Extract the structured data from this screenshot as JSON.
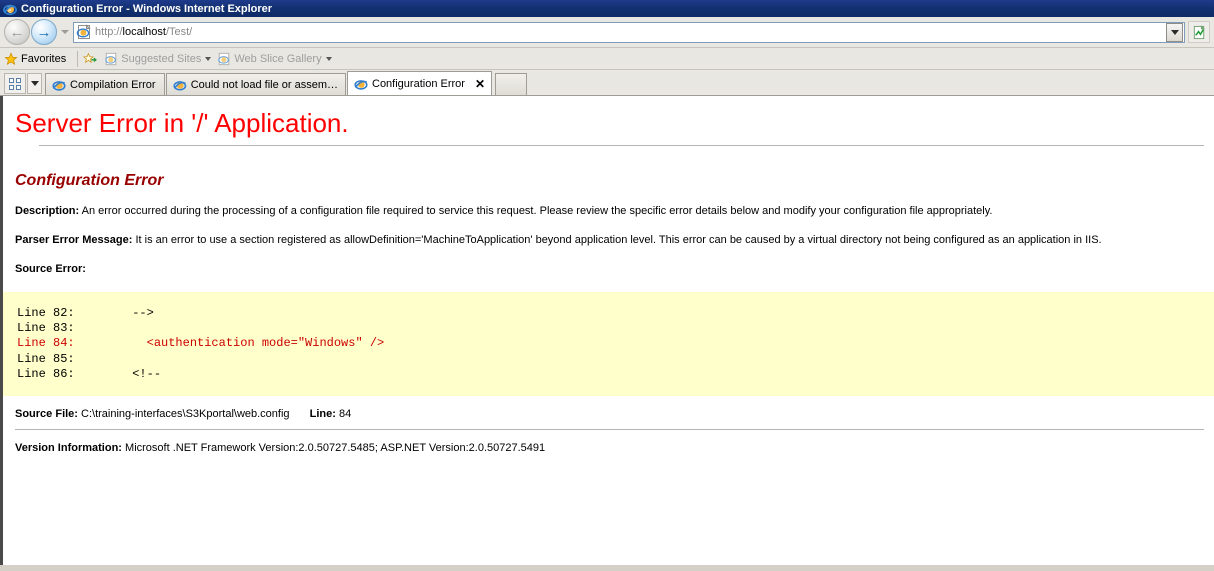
{
  "window": {
    "title": "Configuration Error - Windows Internet Explorer",
    "app_icon": "ie-logo-icon"
  },
  "navigation": {
    "back_label": "Back",
    "forward_label": "Forward",
    "history_dropdown_label": "Recent Pages",
    "address_scheme": "http://",
    "address_host": "localhost",
    "address_path": "/Test/",
    "address_full": "http://localhost/Test/",
    "address_dropdown_label": "Address history",
    "go_label": "Refresh"
  },
  "favorites_bar": {
    "favorites_label": "Favorites",
    "add_to_favorites_label": "Add to Favorites Bar",
    "items": [
      {
        "label": "Suggested Sites",
        "has_caret": true,
        "dimmed": true
      },
      {
        "label": "Web Slice Gallery",
        "has_caret": true,
        "dimmed": true
      }
    ]
  },
  "tabbar": {
    "quick_tabs_label": "Quick Tabs",
    "tab_list_label": "Tab List",
    "new_tab_label": "New Tab",
    "tabs": [
      {
        "label": "Compilation Error",
        "active": false,
        "close_glyph": ""
      },
      {
        "label": "Could not load file or assemb...",
        "active": false,
        "close_glyph": ""
      },
      {
        "label": "Configuration Error",
        "active": true,
        "close_glyph": "✕"
      }
    ]
  },
  "page": {
    "title": "Server Error in '/' Application.",
    "subtitle": "Configuration Error",
    "description_label": "Description:",
    "description_text": "An error occurred during the processing of a configuration file required to service this request. Please review the specific error details below and modify your configuration file appropriately.",
    "parser_label": "Parser Error Message:",
    "parser_text": "It is an error to use a section registered as allowDefinition='MachineToApplication' beyond application level.  This error can be caused by a virtual directory not being configured as an application in IIS.",
    "source_error_label": "Source Error:",
    "code_lines": [
      {
        "line": "Line 82:",
        "code": "        -->",
        "highlight": false
      },
      {
        "line": "Line 83:",
        "code": "",
        "highlight": false
      },
      {
        "line": "Line 84:",
        "code": "          <authentication mode=\"Windows\" />",
        "highlight": true
      },
      {
        "line": "Line 85:",
        "code": "",
        "highlight": false
      },
      {
        "line": "Line 86:",
        "code": "        <!--",
        "highlight": false
      }
    ],
    "code_text": "Line 82:         -->\nLine 83: \nLine 84:           <authentication mode=\"Windows\" />\nLine 85: \nLine 86:         <!--",
    "source_file_label": "Source File:",
    "source_file_value": "C:\\training-interfaces\\S3Kportal\\web.config",
    "line_label": "Line:",
    "line_value": "84",
    "version_label": "Version Information:",
    "version_value": "Microsoft .NET Framework Version:2.0.50727.5485; ASP.NET Version:2.0.50727.5491"
  },
  "colors": {
    "error_red": "#ff0000",
    "subtitle_dark_red": "#990000",
    "code_bg": "#ffffcc",
    "code_highlight": "#cc0000",
    "titlebar_blue": "#12306f",
    "chrome_gray": "#e8e7e2"
  }
}
